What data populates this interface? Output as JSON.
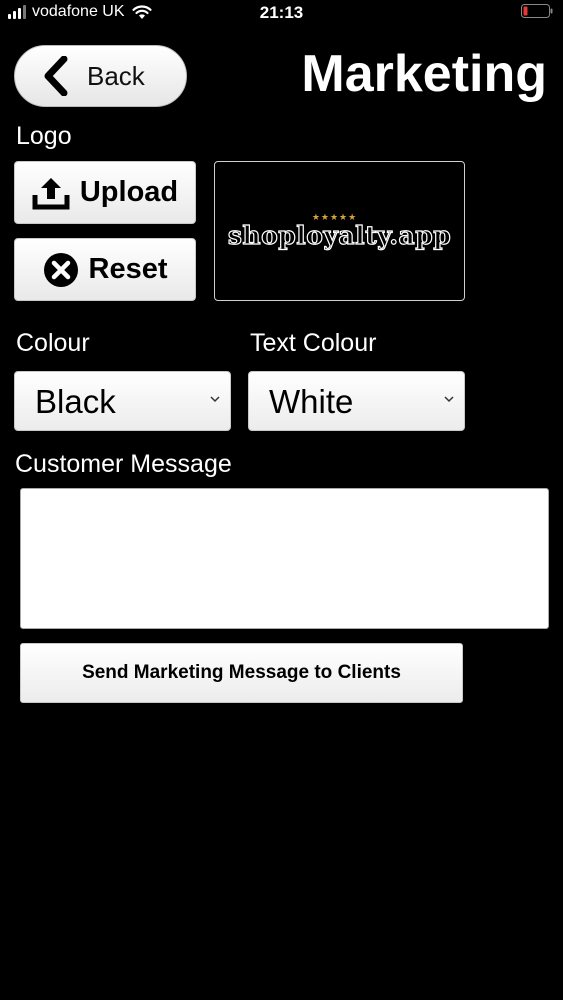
{
  "status_bar": {
    "carrier": "vodafone UK",
    "time": "21:13"
  },
  "header": {
    "back_label": "Back",
    "title": "Marketing"
  },
  "logo": {
    "section_label": "Logo",
    "upload_label": "Upload",
    "reset_label": "Reset",
    "preview_text": "shoployalty.app",
    "preview_stars": "★★★★★"
  },
  "colour": {
    "label": "Colour",
    "selected": "Black"
  },
  "text_colour": {
    "label": "Text Colour",
    "selected": "White"
  },
  "message": {
    "label": "Customer Message",
    "value": ""
  },
  "send_button_label": "Send Marketing Message to Clients",
  "colors": {
    "background": "#000000",
    "button_bg": "#ffffff",
    "battery_low": "#e53935",
    "star": "#d7a33a"
  },
  "icons": [
    "signal-icon",
    "wifi-icon",
    "battery-icon",
    "chevron-left-icon",
    "upload-icon",
    "reset-x-icon",
    "chevron-down-icon"
  ]
}
